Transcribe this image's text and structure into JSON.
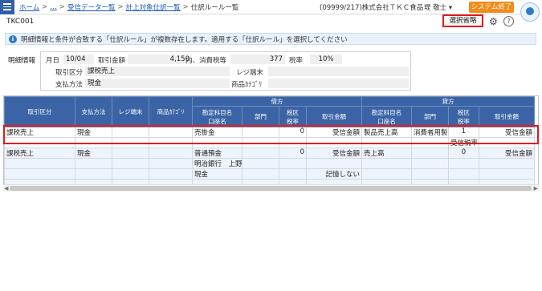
{
  "topbar": {
    "breadcrumbs": [
      "ホーム",
      "…",
      "受信データ一覧",
      "計上対象仕訳一覧"
    ],
    "separator": ">",
    "current": "仕訳ルール一覧",
    "company": "(09999/217)株式会社ＴＫＣ食品",
    "user": "堤 敬士",
    "end_button": "システム終了"
  },
  "header": {
    "code": "TKC001",
    "omit_button": "選択省略",
    "help": "?"
  },
  "info": {
    "icon": "i",
    "text": "明細情報と条件が合致する「仕訳ルール」が複数存在します。適用する「仕訳ルール」を選択してください"
  },
  "detail": {
    "title": "明細情報",
    "date_label": "月日",
    "date_value": "10/04",
    "amount_label": "取引金額",
    "amount_value": "4,150",
    "tax_label": "内、消費税等",
    "tax_value": "377",
    "rate_label": "税率",
    "rate_value": "10%",
    "txn_label": "取引区分",
    "txn_value": "課税売上",
    "register_label": "レジ端末",
    "register_value": "",
    "payment_label": "支払方法",
    "payment_value": "現金",
    "product_label": "商品ｶﾃｺﾞﾘ",
    "product_value": ""
  },
  "grid": {
    "headers": {
      "txn": "取引区分",
      "payment": "支払方法",
      "register": "レジ端末",
      "product": "商品ｶﾃｺﾞﾘ",
      "debit": "借方",
      "credit": "貸方",
      "account": "勘定科目名",
      "account_sub": "口座名",
      "dept": "部門",
      "tax": "税区",
      "tax_sub": "税率",
      "amount": "取引金額"
    },
    "rows": [
      {
        "txn": "課税売上",
        "payment": "現金",
        "register": "",
        "product": "",
        "d_account": "売掛金",
        "d_account2": "",
        "d_dept": "",
        "d_tax": "0",
        "d_tax2": "",
        "d_amount": "受信金額",
        "c_account": "製品売上高",
        "c_dept": "消費者用製",
        "c_tax": "1",
        "c_tax2": "受信税率",
        "c_amount": "受信金額"
      },
      {
        "txn": "課税売上",
        "payment": "現金",
        "register": "",
        "product": "",
        "d_account": "普通預金",
        "d_account2": "明治銀行　上野",
        "d_dept": "",
        "d_tax": "0",
        "d_tax2": "",
        "d_amount": "受信金額",
        "c_account": "売上高",
        "c_dept": "",
        "c_tax": "0",
        "c_tax2": "",
        "c_amount": "受信金額"
      },
      {
        "txn": "",
        "payment": "",
        "register": "",
        "product": "",
        "d_account": "現金",
        "d_account2": "",
        "d_dept": "",
        "d_tax": "",
        "d_tax2": "",
        "d_amount": "記憶しない",
        "c_account": "",
        "c_dept": "",
        "c_tax": "",
        "c_tax2": "",
        "c_amount": ""
      }
    ]
  }
}
